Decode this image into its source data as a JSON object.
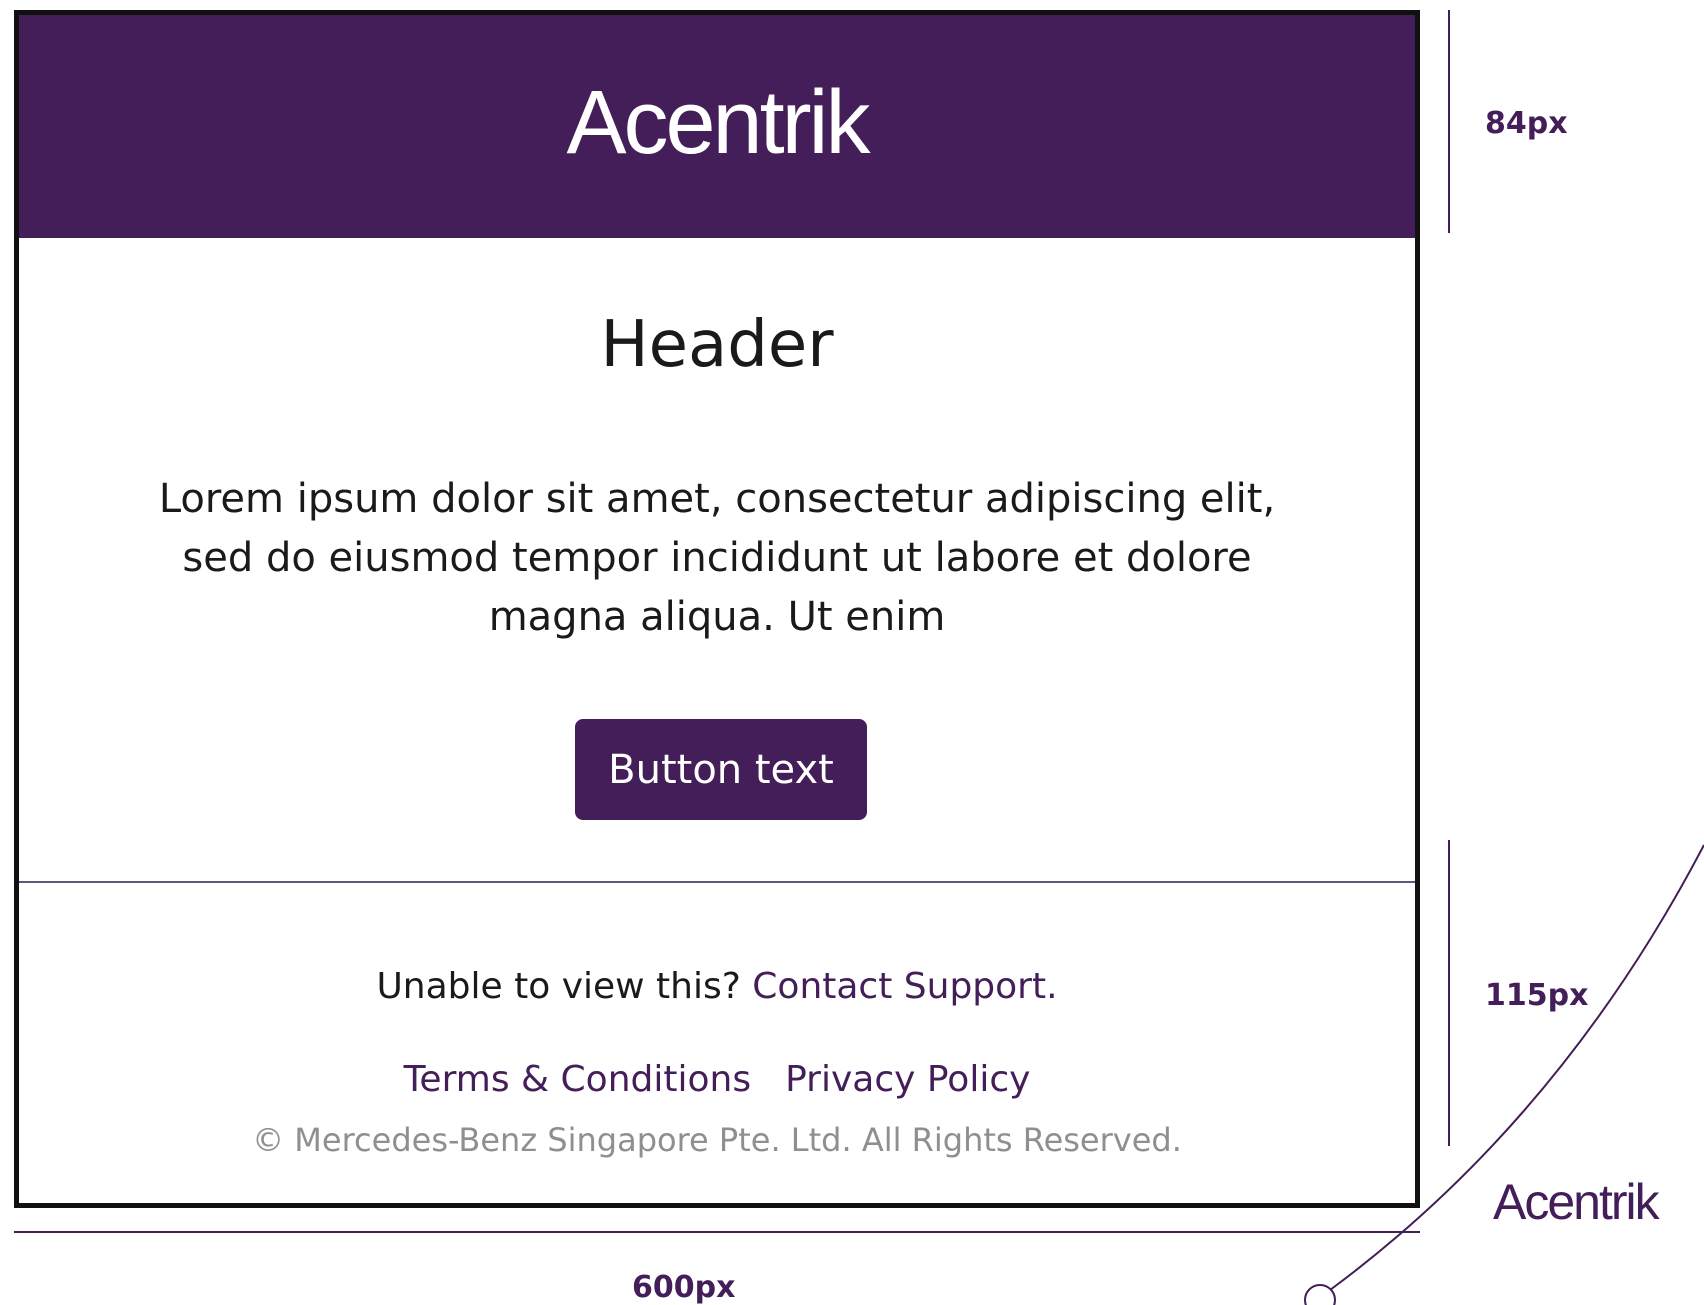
{
  "email": {
    "brand": {
      "logo_text": "Acentrik",
      "color": "#431e58"
    },
    "content": {
      "heading": "Header",
      "body": "Lorem ipsum dolor sit amet, consectetur adipiscing elit, sed do eiusmod tempor incididunt ut labore et dolore magna aliqua. Ut enim",
      "button_label": "Button text"
    },
    "footer": {
      "unable_text": "Unable to view this? ",
      "contact_link": "Contact Support.",
      "terms_link": "Terms & Conditions",
      "privacy_link": "Privacy Policy",
      "copyright": "© Mercedes-Benz Singapore Pte. Ltd. All Rights Reserved."
    }
  },
  "annotations": {
    "header_height_label": "84px",
    "footer_height_label": "115px",
    "width_label": "600px"
  },
  "side_logo_text": "Acentrik"
}
